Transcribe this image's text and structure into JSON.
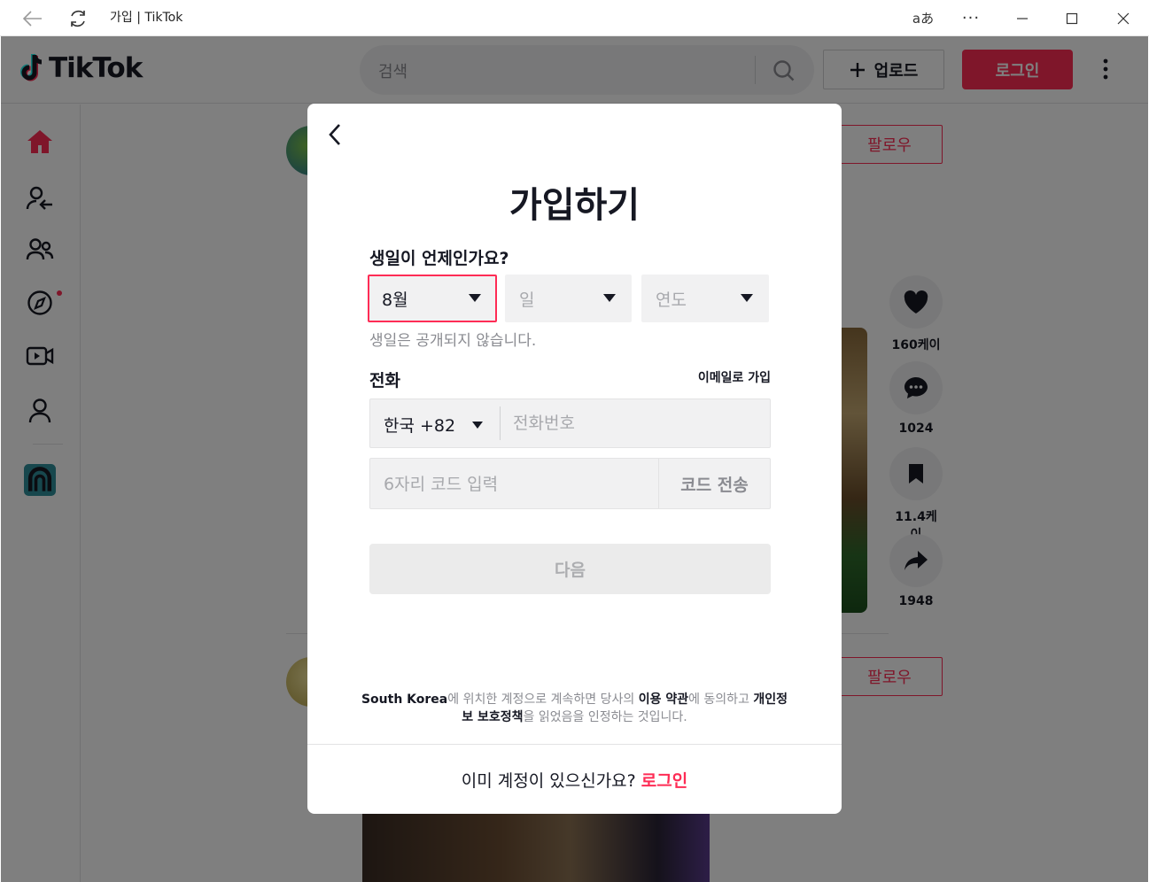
{
  "window": {
    "title": "가입 | TikTok"
  },
  "colors": {
    "brand": "#fe2c55",
    "text": "#161823",
    "muted": "#8a8b91"
  },
  "header": {
    "logo_text": "TikTok",
    "search_placeholder": "검색",
    "upload_label": "업로드",
    "login_label": "로그인"
  },
  "sidebar": {
    "items": [
      "home-icon",
      "following-icon",
      "friends-icon",
      "explore-icon",
      "live-icon",
      "profile-icon"
    ]
  },
  "feed": {
    "follow_label": "팔로우",
    "actions": [
      {
        "icon": "heart-icon",
        "count": "160케이"
      },
      {
        "icon": "comment-icon",
        "count": "1024"
      },
      {
        "icon": "bookmark-icon",
        "count": "11.4케이"
      },
      {
        "icon": "share-icon",
        "count": "1948"
      }
    ]
  },
  "modal": {
    "title": "가입하기",
    "birthday_label": "생일이 언제인가요?",
    "month_value": "8월",
    "day_placeholder": "일",
    "year_placeholder": "연도",
    "birthday_hint": "생일은 공개되지 않습니다.",
    "phone_label": "전화",
    "email_signup": "이메일로 가입",
    "country_code": "한국 +82",
    "phone_placeholder": "전화번호",
    "code_placeholder": "6자리 코드 입력",
    "send_code": "코드 전송",
    "next": "다음",
    "terms": {
      "country": "South Korea",
      "part1": "에 위치한 계정으로 계속하면 당사의 ",
      "terms_link": "이용 약관",
      "part2": "에 동의하고 ",
      "privacy_link": "개인정보 보호정책",
      "part3": "을 읽었음을 인정하는 것입니다."
    },
    "footer_text": "이미 계정이 있으신가요?",
    "footer_link": "로그인"
  }
}
